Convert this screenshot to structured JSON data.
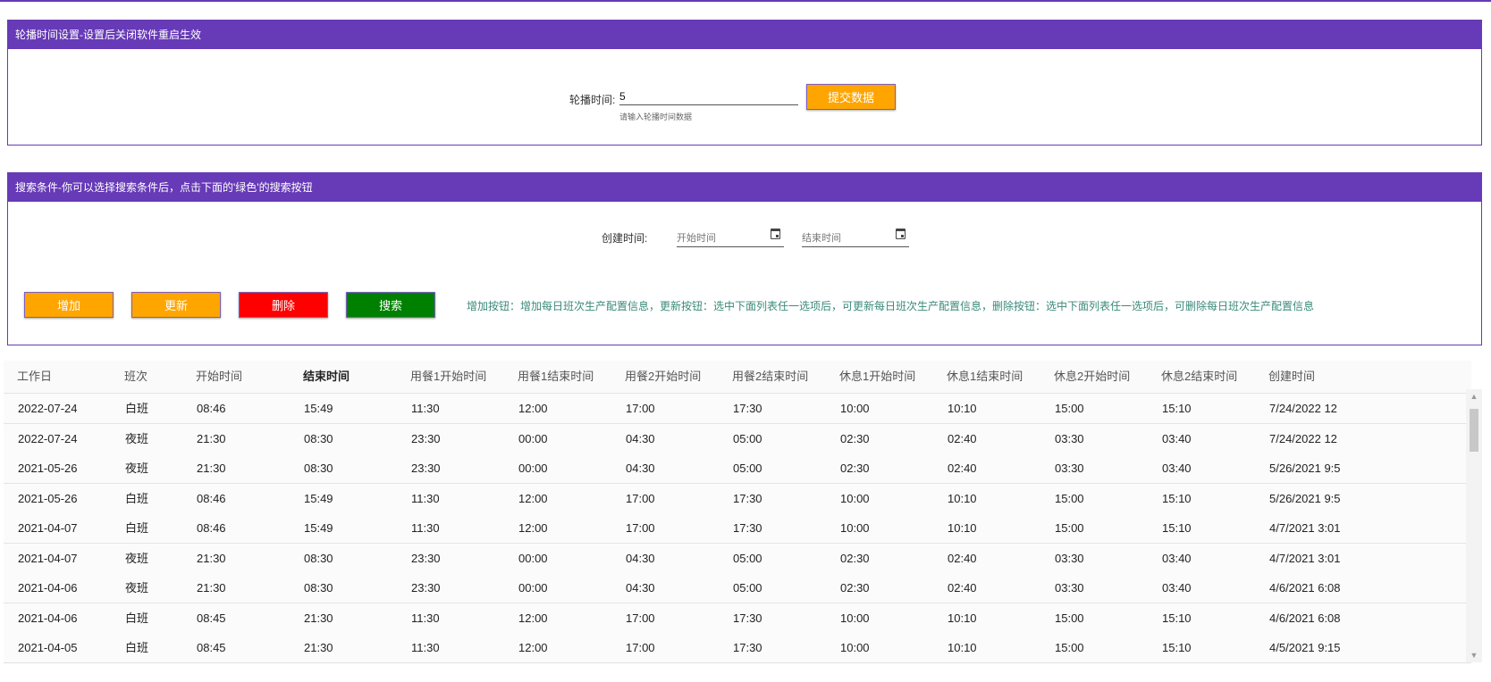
{
  "carousel_panel": {
    "title": "轮播时间设置-设置后关闭软件重启生效",
    "label": "轮播时间:",
    "value": "5",
    "hint": "请输入轮播时间数据",
    "submit_label": "提交数据"
  },
  "search_panel": {
    "title": "搜索条件-你可以选择搜索条件后，点击下面的'绿色'的搜索按钮",
    "created_label": "创建时间:",
    "start_placeholder": "开始时间",
    "end_placeholder": "结束时间",
    "buttons": {
      "add": "增加",
      "update": "更新",
      "delete": "删除",
      "search": "搜索"
    },
    "help": "增加按钮：增加每日班次生产配置信息，更新按钮：选中下面列表任一选项后，可更新每日班次生产配置信息，删除按钮：选中下面列表任一选项后，可删除每日班次生产配置信息"
  },
  "colors": {
    "primary": "#673ab7",
    "orange": "#ffa500",
    "red": "#ff0000",
    "green": "#008000",
    "help_text": "#3a8a7a"
  },
  "table": {
    "columns": [
      "工作日",
      "班次",
      "开始时间",
      "结束时间",
      "用餐1开始时间",
      "用餐1结束时间",
      "用餐2开始时间",
      "用餐2结束时间",
      "休息1开始时间",
      "休息1结束时间",
      "休息2开始时间",
      "休息2结束时间",
      "创建时间"
    ],
    "rows": [
      [
        "2022-07-24",
        "白班",
        "08:46",
        "15:49",
        "11:30",
        "12:00",
        "17:00",
        "17:30",
        "10:00",
        "10:10",
        "15:00",
        "15:10",
        "7/24/2022 12"
      ],
      [
        "2022-07-24",
        "夜班",
        "21:30",
        "08:30",
        "23:30",
        "00:00",
        "04:30",
        "05:00",
        "02:30",
        "02:40",
        "03:30",
        "03:40",
        "7/24/2022 12"
      ],
      [
        "2021-05-26",
        "夜班",
        "21:30",
        "08:30",
        "23:30",
        "00:00",
        "04:30",
        "05:00",
        "02:30",
        "02:40",
        "03:30",
        "03:40",
        "5/26/2021 9:5"
      ],
      [
        "2021-05-26",
        "白班",
        "08:46",
        "15:49",
        "11:30",
        "12:00",
        "17:00",
        "17:30",
        "10:00",
        "10:10",
        "15:00",
        "15:10",
        "5/26/2021 9:5"
      ],
      [
        "2021-04-07",
        "白班",
        "08:46",
        "15:49",
        "11:30",
        "12:00",
        "17:00",
        "17:30",
        "10:00",
        "10:10",
        "15:00",
        "15:10",
        "4/7/2021 3:01"
      ],
      [
        "2021-04-07",
        "夜班",
        "21:30",
        "08:30",
        "23:30",
        "00:00",
        "04:30",
        "05:00",
        "02:30",
        "02:40",
        "03:30",
        "03:40",
        "4/7/2021 3:01"
      ],
      [
        "2021-04-06",
        "夜班",
        "21:30",
        "08:30",
        "23:30",
        "00:00",
        "04:30",
        "05:00",
        "02:30",
        "02:40",
        "03:30",
        "03:40",
        "4/6/2021 6:08"
      ],
      [
        "2021-04-06",
        "白班",
        "08:45",
        "21:30",
        "11:30",
        "12:00",
        "17:00",
        "17:30",
        "10:00",
        "10:10",
        "15:00",
        "15:10",
        "4/6/2021 6:08"
      ],
      [
        "2021-04-05",
        "白班",
        "08:45",
        "21:30",
        "11:30",
        "12:00",
        "17:00",
        "17:30",
        "10:00",
        "10:10",
        "15:00",
        "15:10",
        "4/5/2021 9:15"
      ]
    ]
  }
}
